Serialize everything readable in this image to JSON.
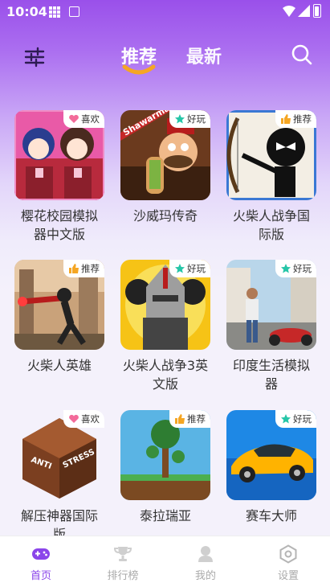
{
  "status": {
    "time": "10:04"
  },
  "header": {
    "tabs": [
      {
        "label": "推荐",
        "active": true
      },
      {
        "label": "最新",
        "active": false
      }
    ]
  },
  "games": [
    {
      "title": "樱花校园模拟器中文版",
      "badge": "喜欢",
      "badge_icon": "heart-icon"
    },
    {
      "title": "沙威玛传奇",
      "badge": "好玩",
      "badge_icon": "star-icon"
    },
    {
      "title": "火柴人战争国际版",
      "badge": "推荐",
      "badge_icon": "thumbs-up-icon"
    },
    {
      "title": "火柴人英雄",
      "badge": "推荐",
      "badge_icon": "thumbs-up-icon"
    },
    {
      "title": "火柴人战争3英文版",
      "badge": "好玩",
      "badge_icon": "star-icon"
    },
    {
      "title": "印度生活模拟器",
      "badge": "好玩",
      "badge_icon": "star-icon"
    },
    {
      "title": "解压神器国际版",
      "badge": "喜欢",
      "badge_icon": "heart-icon"
    },
    {
      "title": "泰拉瑞亚",
      "badge": "推荐",
      "badge_icon": "thumbs-up-icon"
    },
    {
      "title": "赛车大师",
      "badge": "好玩",
      "badge_icon": "star-icon"
    }
  ],
  "thumb_text": {
    "shawarma": "Shawarma",
    "anti": "ANTI",
    "stress": "STRESS"
  },
  "bottom_nav": [
    {
      "label": "首页",
      "icon": "gamepad-icon",
      "active": true
    },
    {
      "label": "排行榜",
      "icon": "trophy-icon",
      "active": false
    },
    {
      "label": "我的",
      "icon": "user-icon",
      "active": false
    },
    {
      "label": "设置",
      "icon": "settings-icon",
      "active": false
    }
  ],
  "colors": {
    "accent": "#8b45ea",
    "indicator": "#f5a623",
    "heart": "#f36b9a",
    "star": "#26c6a8",
    "thumb": "#f5a623"
  }
}
